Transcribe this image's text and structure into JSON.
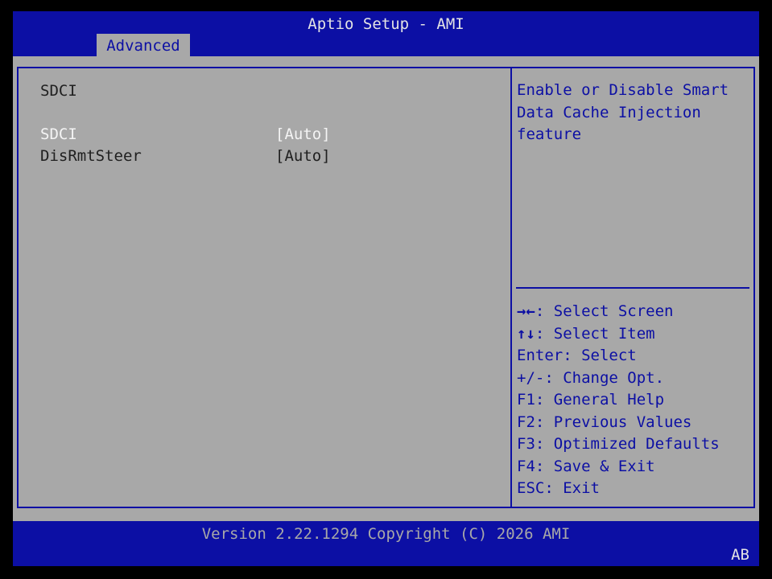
{
  "header": {
    "title": "Aptio Setup - AMI",
    "active_tab": "Advanced"
  },
  "section_title": "SDCI",
  "settings": [
    {
      "label": "SDCI",
      "value": "[Auto]",
      "selected": true
    },
    {
      "label": "DisRmtSteer",
      "value": "[Auto]",
      "selected": false
    }
  ],
  "help_text": [
    "Enable or Disable Smart",
    "Data Cache Injection",
    "feature"
  ],
  "key_help": [
    {
      "key": "→←",
      "desc": ": Select Screen"
    },
    {
      "key": "↑↓",
      "desc": ": Select Item"
    },
    {
      "key": "",
      "desc": "Enter: Select"
    },
    {
      "key": "",
      "desc": "+/-: Change Opt."
    },
    {
      "key": "",
      "desc": "F1: General Help"
    },
    {
      "key": "",
      "desc": "F2: Previous Values"
    },
    {
      "key": "",
      "desc": "F3: Optimized Defaults"
    },
    {
      "key": "",
      "desc": "F4: Save & Exit"
    },
    {
      "key": "",
      "desc": "ESC: Exit"
    }
  ],
  "footer": {
    "version_text": "Version 2.22.1294 Copyright (C) 2026 AMI",
    "badge": "AB"
  },
  "colors": {
    "bios_blue": "#0c0fa4",
    "panel_gray": "#a8a8a8",
    "highlight_white": "#f4f4f4"
  }
}
